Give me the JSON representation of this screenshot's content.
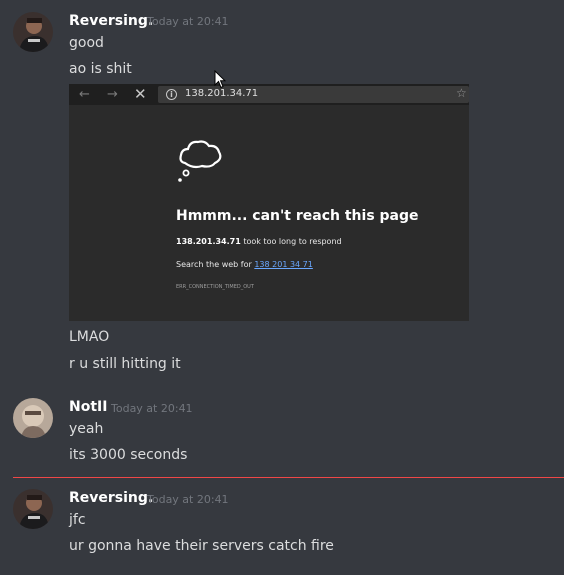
{
  "messages": [
    {
      "username": "Reversing.",
      "timestamp": "Today at 20:41",
      "lines": [
        "good",
        "ao is shit"
      ],
      "embed": {
        "url": "138.201.34.71",
        "error_title": "Hmmm... can't reach this page",
        "error_host": "138.201.34.71",
        "error_rest": " took too long to respond",
        "search_prefix": "Search the web for ",
        "search_link": "138 201 34 71",
        "error_code": "ERR_CONNECTION_TIMED_OUT"
      },
      "after": [
        "LMAO",
        "r u still hitting it"
      ]
    },
    {
      "username": "NotII",
      "timestamp": "Today at 20:41",
      "lines": [
        "yeah",
        "its 3000 seconds"
      ]
    },
    {
      "username": "Reversing.",
      "timestamp": "Today at 20:41",
      "lines": [
        "jfc",
        "ur gonna have their servers catch fire"
      ]
    }
  ],
  "colors": {
    "background": "#36393f",
    "new_messages_divider": "#f04747",
    "username": "#ffffff",
    "timestamp": "#72767d"
  },
  "icons": {
    "back": "arrow-left",
    "forward": "arrow-right",
    "stop": "close",
    "site_info": "info",
    "favorite": "star",
    "error": "thought-cloud"
  }
}
